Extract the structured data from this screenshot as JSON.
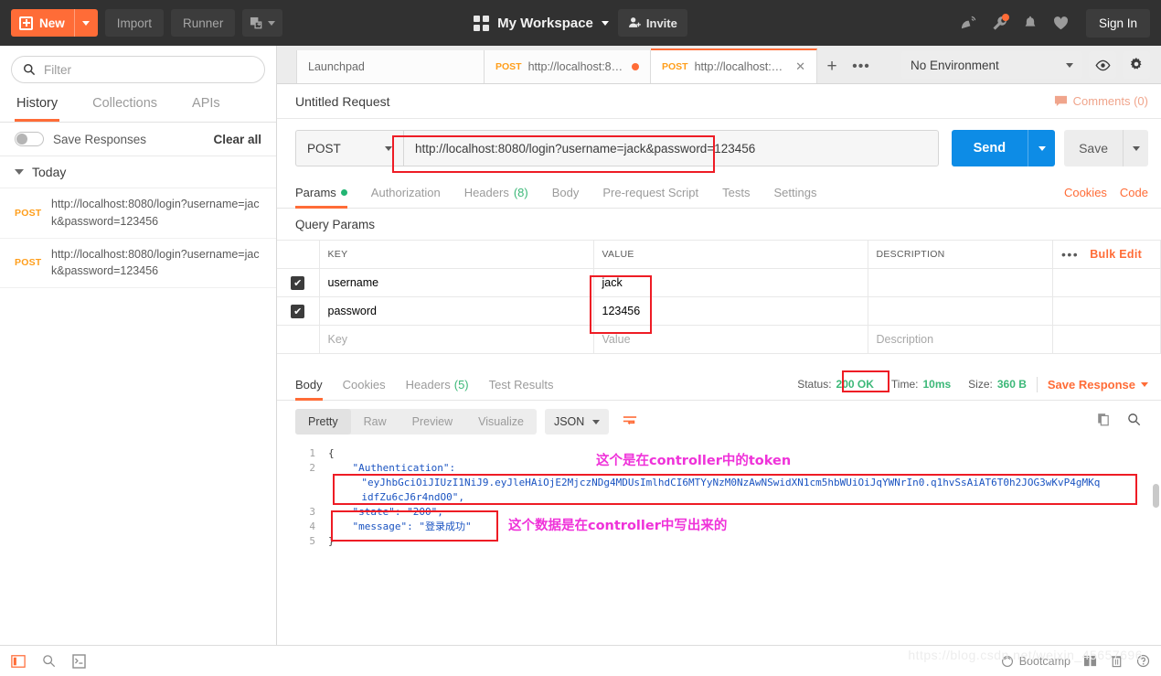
{
  "topbar": {
    "new_label": "New",
    "import_label": "Import",
    "runner_label": "Runner",
    "workspace_label": "My Workspace",
    "invite_label": "Invite",
    "signin_label": "Sign In",
    "icons": [
      "new-window-icon",
      "satellite-icon",
      "wrench-icon",
      "bell-icon",
      "heart-icon"
    ]
  },
  "sidebar": {
    "filter_placeholder": "Filter",
    "tabs": [
      {
        "label": "History",
        "active": true
      },
      {
        "label": "Collections",
        "active": false
      },
      {
        "label": "APIs",
        "active": false
      }
    ],
    "save_responses_label": "Save Responses",
    "clear_all_label": "Clear all",
    "group_label": "Today",
    "history": [
      {
        "method": "POST",
        "url": "http://localhost:8080/login?username=jack&password=123456"
      },
      {
        "method": "POST",
        "url": "http://localhost:8080/login?username=jack&password=123456"
      }
    ]
  },
  "tabstrip": {
    "tabs": [
      {
        "title": "Launchpad",
        "method": "",
        "unsaved": false,
        "active": false
      },
      {
        "title": "http://localhost:8080/lo...",
        "method": "POST",
        "unsaved": true,
        "active": false
      },
      {
        "title": "http://localhost:8080/lo...",
        "method": "POST",
        "unsaved": false,
        "active": true
      }
    ],
    "add_label": "+",
    "more_label": "•••",
    "environment": "No Environment",
    "eye_icon": "eye-icon",
    "gear_icon": "gear-icon"
  },
  "request": {
    "title": "Untitled Request",
    "comments_label": "Comments (0)",
    "method": "POST",
    "url": "http://localhost:8080/login?username=jack&password=123456",
    "send_label": "Send",
    "save_label": "Save",
    "tabs": [
      {
        "label": "Params",
        "dot": true,
        "count": "",
        "active": true
      },
      {
        "label": "Authorization",
        "dot": false,
        "count": "",
        "active": false
      },
      {
        "label": "Headers",
        "dot": false,
        "count": "(8)",
        "active": false
      },
      {
        "label": "Body",
        "dot": false,
        "count": "",
        "active": false
      },
      {
        "label": "Pre-request Script",
        "dot": false,
        "count": "",
        "active": false
      },
      {
        "label": "Tests",
        "dot": false,
        "count": "",
        "active": false
      },
      {
        "label": "Settings",
        "dot": false,
        "count": "",
        "active": false
      }
    ],
    "cookies_label": "Cookies",
    "code_label": "Code"
  },
  "query_params": {
    "section_title": "Query Params",
    "headers": [
      "KEY",
      "VALUE",
      "DESCRIPTION"
    ],
    "more_label": "•••",
    "bulk_edit_label": "Bulk Edit",
    "rows": [
      {
        "checked": true,
        "key": "username",
        "value": "jack",
        "description": ""
      },
      {
        "checked": true,
        "key": "password",
        "value": "123456",
        "description": ""
      }
    ],
    "placeholder_row": {
      "key": "Key",
      "value": "Value",
      "description": "Description"
    }
  },
  "response": {
    "tabs": [
      {
        "label": "Body",
        "count": "",
        "active": true
      },
      {
        "label": "Cookies",
        "count": "",
        "active": false
      },
      {
        "label": "Headers",
        "count": "(5)",
        "active": false
      },
      {
        "label": "Test Results",
        "count": "",
        "active": false
      }
    ],
    "status_key": "Status:",
    "status_value": "200 OK",
    "time_key": "Time:",
    "time_value": "10ms",
    "size_key": "Size:",
    "size_value": "360 B",
    "save_response_label": "Save Response",
    "view_modes": [
      {
        "label": "Pretty",
        "active": true
      },
      {
        "label": "Raw",
        "active": false
      },
      {
        "label": "Preview",
        "active": false
      },
      {
        "label": "Visualize",
        "active": false
      }
    ],
    "format": "JSON",
    "wrap_icon": "wrap-lines-icon",
    "copy_icon": "copy-icon",
    "search_icon": "search-icon",
    "code_lines": [
      {
        "n": "1",
        "text": "{"
      },
      {
        "n": "2",
        "text": "    \"Authentication\":"
      },
      {
        "n": "",
        "text": "        \"eyJhbGciOiJIUzI1NiJ9.eyJleHAiOjE2MjczNDg4MDUsImlhdCI6MTYyNzM0NzAwNSwid XN1cm5hbWUiOiJqYWNrIn0.q1hvSsAiAT6T0h2JOG3wKvP4gMKq"
      },
      {
        "n": "",
        "text": "        idfZu6cJ6r4ndO0\","
      },
      {
        "n": "3",
        "text": "    \"state\": \"200\","
      },
      {
        "n": "4",
        "text": "    \"message\": \"登录成功\""
      },
      {
        "n": "5",
        "text": "}"
      }
    ],
    "token_line_1": "\"eyJhbGciOiJIUzI1NiJ9.eyJleHAiOjE2MjczNDg4MDUsImlhdCI6MTYyNzM0NzAwNSwidXN1cm5hbWUiOiJqYWNrIn0.q1hvSsAiAT6T0h2JOG3wKvP4gMKq",
    "token_line_2": "idfZu6cJ6r4ndO0\",",
    "auth_key": "    \"Authentication\":",
    "state_line": "    \"state\": \"200\",",
    "message_line": "    \"message\": \"登录成功\"",
    "open_brace": "{",
    "close_brace": "}"
  },
  "annotations": [
    {
      "text": "这个是在controller中的token",
      "color": "#ef32d9"
    },
    {
      "text": "这个数据是在controller中写出来的",
      "color": "#ef32d9"
    }
  ],
  "bottombar": {
    "icons": [
      "sidebar-toggle-icon",
      "find-icon",
      "console-icon"
    ],
    "bootcamp_label": "Bootcamp",
    "right_icons": [
      "two-pane-icon",
      "trash-icon",
      "help-icon"
    ],
    "watermark": "https://blog.csdn.net/weixin_45657696"
  },
  "colors": {
    "accent": "#ff6c37",
    "send": "#0d8ce6",
    "success": "#3cb878",
    "annotation_box": "#ee1c25",
    "annotation_text": "#ef32d9",
    "method": "#ff9e1b"
  }
}
